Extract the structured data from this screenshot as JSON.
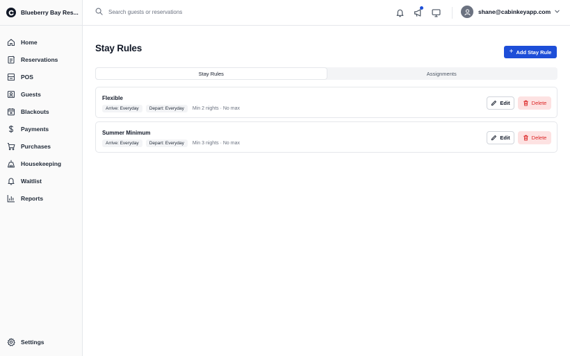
{
  "brand": {
    "name": "Blueberry Bay Res..."
  },
  "sidebar": {
    "items": [
      {
        "label": "Home",
        "icon": "home-icon"
      },
      {
        "label": "Reservations",
        "icon": "clipboard-icon"
      },
      {
        "label": "POS",
        "icon": "register-icon"
      },
      {
        "label": "Guests",
        "icon": "guest-icon"
      },
      {
        "label": "Blackouts",
        "icon": "calendar-icon"
      },
      {
        "label": "Payments",
        "icon": "dollar-icon"
      },
      {
        "label": "Purchases",
        "icon": "cart-icon"
      },
      {
        "label": "Housekeeping",
        "icon": "housekeeping-icon"
      },
      {
        "label": "Waitlist",
        "icon": "bell-icon"
      },
      {
        "label": "Reports",
        "icon": "bar-chart-icon"
      }
    ],
    "settings_label": "Settings"
  },
  "topbar": {
    "search_placeholder": "Search guests or reservations",
    "user_email": "shane@cabinkeyapp.com",
    "accent_color": "#1d4ed8"
  },
  "main": {
    "title": "Stay Rules",
    "add_button_label": "Add Stay Rule",
    "tabs": [
      {
        "label": "Stay Rules",
        "active": true
      },
      {
        "label": "Assignments",
        "active": false
      }
    ],
    "rules": [
      {
        "name": "Flexible",
        "arrive": "Arrive: Everyday",
        "depart": "Depart: Everyday",
        "nights": "Min 2 nights · No max"
      },
      {
        "name": "Summer Minimum",
        "arrive": "Arrive: Everyday",
        "depart": "Depart: Everyday",
        "nights": "Min 3 nights · No max"
      }
    ],
    "edit_label": "Edit",
    "delete_label": "Delete"
  }
}
